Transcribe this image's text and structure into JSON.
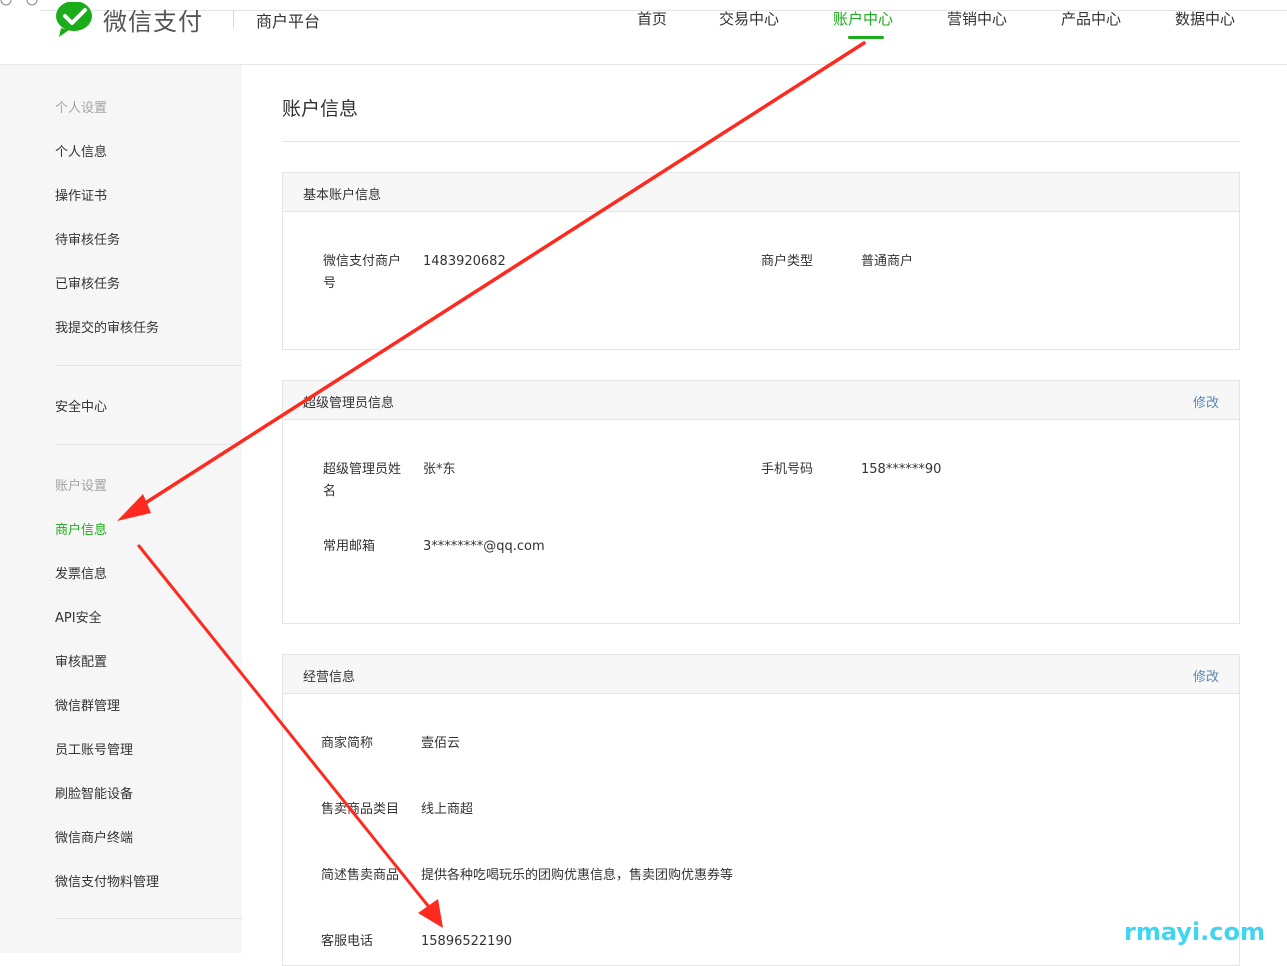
{
  "brand": {
    "logo_text": "微信支付",
    "platform": "商户平台",
    "accent": "#1aad19"
  },
  "nav": {
    "items": [
      "首页",
      "交易中心",
      "账户中心",
      "营销中心",
      "产品中心",
      "数据中心"
    ],
    "active": "账户中心"
  },
  "sidebar": {
    "group_personal": "个人设置",
    "personal_items": [
      "个人信息",
      "操作证书",
      "待审核任务",
      "已审核任务",
      "我提交的审核任务"
    ],
    "security": "安全中心",
    "group_account": "账户设置",
    "account_items": [
      "商户信息",
      "发票信息",
      "API安全",
      "审核配置",
      "微信群管理",
      "员工账号管理",
      "刷脸智能设备",
      "微信商户终端",
      "微信支付物料管理"
    ],
    "active": "商户信息"
  },
  "page": {
    "title": "账户信息"
  },
  "basic": {
    "title": "基本账户信息",
    "merchant_id_label": "微信支付商户号",
    "merchant_id": "1483920682",
    "type_label": "商户类型",
    "type": "普通商户"
  },
  "admin": {
    "title": "超级管理员信息",
    "edit": "修改",
    "name_label": "超级管理员姓名",
    "name": "张*东",
    "phone_label": "手机号码",
    "phone": "158******90",
    "email_label": "常用邮箱",
    "email": "3********@qq.com"
  },
  "business": {
    "title": "经营信息",
    "edit": "修改",
    "short_name_label": "商家简称",
    "short_name": "壹佰云",
    "category_label": "售卖商品类目",
    "category": "线上商超",
    "desc_label": "简述售卖商品",
    "desc": "提供各种吃喝玩乐的团购优惠信息，售卖团购优惠券等",
    "service_phone_label": "客服电话",
    "service_phone": "15896522190"
  },
  "watermark": "rmayi.com",
  "annotation_color": "#ff2a1f"
}
